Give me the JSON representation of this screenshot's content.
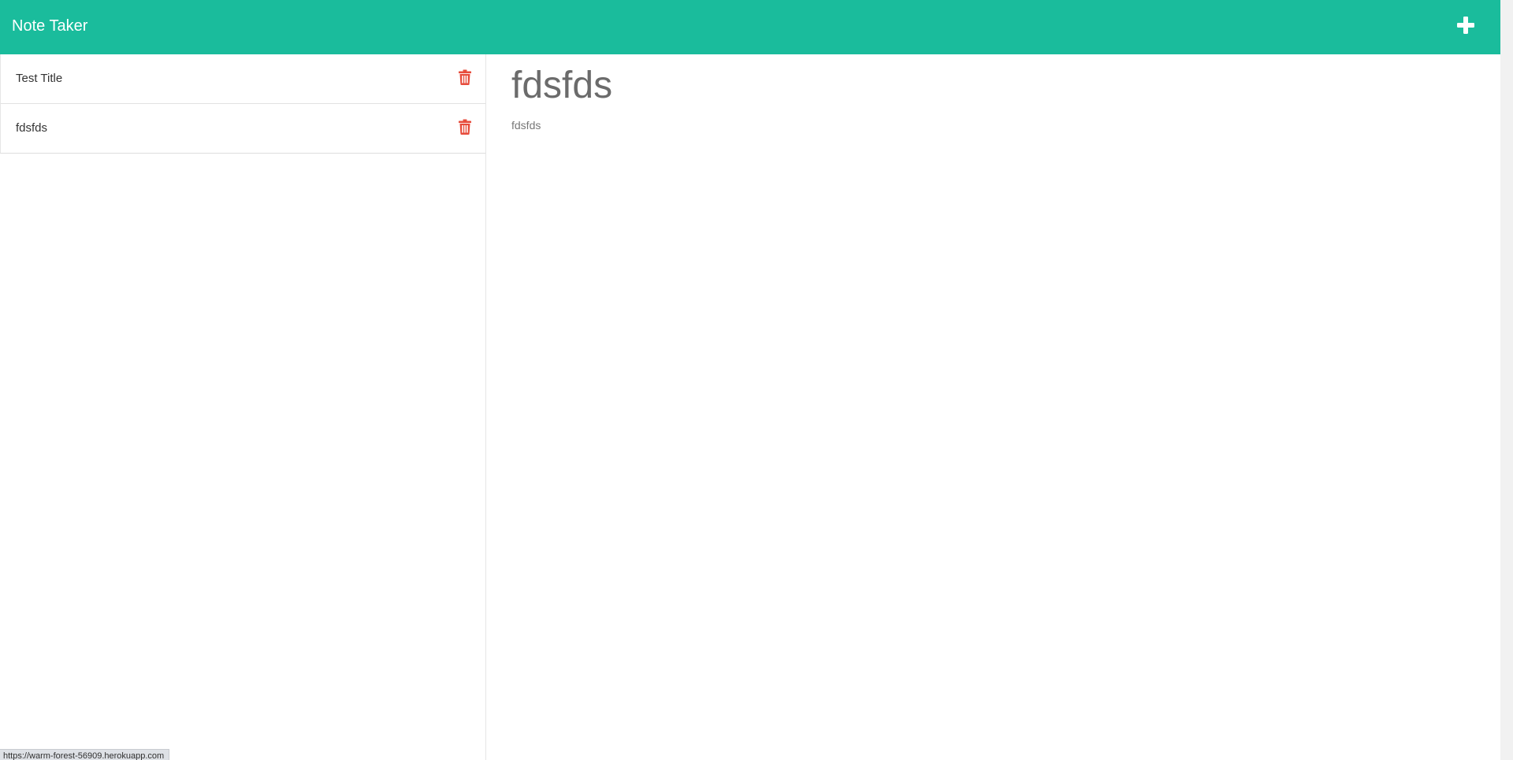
{
  "navbar": {
    "brand": "Note Taker",
    "background_color": "#1abc9c",
    "add_icon": "plus-icon"
  },
  "sidebar": {
    "notes": [
      {
        "title": "Test Title",
        "delete_icon": "trash-icon"
      },
      {
        "title": "fdsfds",
        "delete_icon": "trash-icon"
      }
    ],
    "delete_icon_color": "#e74c3c"
  },
  "main": {
    "note_title": "fdsfds",
    "note_text": "fdsfds"
  },
  "status_bar": {
    "url": "https://warm-forest-56909.herokuapp.com"
  }
}
